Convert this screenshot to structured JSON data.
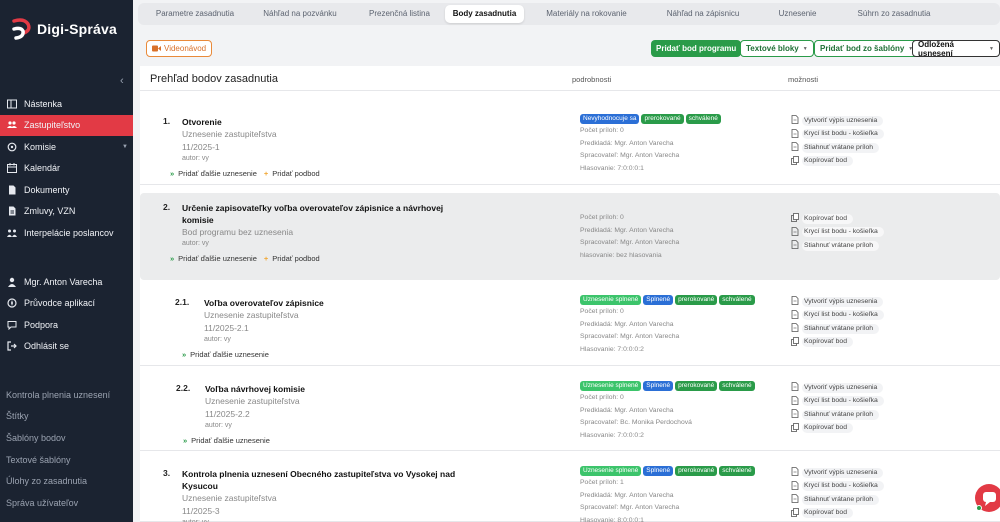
{
  "app": {
    "name": "Digi-Správa",
    "colors": {
      "sidebar": "#1b2331",
      "accent": "#e23a45",
      "green": "#2a9b49",
      "blue": "#2b6fd6"
    }
  },
  "sidebar": {
    "collapse_icon": "chevron-left-icon",
    "items": [
      {
        "label": "Nástenka",
        "icon": "dashboard-icon",
        "active": false
      },
      {
        "label": "Zastupiteľstvo",
        "icon": "users-icon",
        "active": true
      },
      {
        "label": "Komisie",
        "icon": "committee-icon",
        "active": false,
        "has_dropdown": true
      },
      {
        "label": "Kalendár",
        "icon": "calendar-icon",
        "active": false
      },
      {
        "label": "Dokumenty",
        "icon": "document-icon",
        "active": false
      },
      {
        "label": "Zmluvy, VZN",
        "icon": "contract-icon",
        "active": false
      },
      {
        "label": "Interpelácie poslancov",
        "icon": "interpellation-icon",
        "active": false
      }
    ],
    "user_items": [
      {
        "label": "Mgr. Anton Varecha",
        "icon": "user-icon"
      },
      {
        "label": "Průvodce aplikací",
        "icon": "compass-icon"
      },
      {
        "label": "Podpora",
        "icon": "support-icon"
      },
      {
        "label": "Odhlásit se",
        "icon": "logout-icon"
      }
    ],
    "secondary_items": [
      "Kontrola plnenia uznesení",
      "Štítky",
      "Šablóny bodov",
      "Textové šablóny",
      "Úlohy zo zasadnutia",
      "Správa užívateľov"
    ]
  },
  "tabs": [
    {
      "label": "Parametre zasadnutia",
      "active": false
    },
    {
      "label": "Náhľad na pozvánku",
      "active": false
    },
    {
      "label": "Prezenčná listina",
      "active": false
    },
    {
      "label": "Body zasadnutia",
      "active": true
    },
    {
      "label": "Materiály na rokovanie",
      "active": false
    },
    {
      "label": "Náhľad na zápisnicu",
      "active": false
    },
    {
      "label": "Uznesenie",
      "active": false
    },
    {
      "label": "Súhrn zo zasadnutia",
      "active": false
    }
  ],
  "toolbar": {
    "video": "Videonávod",
    "add_point": "Pridať bod programu",
    "text_blocks": "Textové bloky",
    "add_from_template": "Pridať bod zo šablóny",
    "deferred": "Odložená usnesení"
  },
  "panel": {
    "title": "Prehľad bodov zasadnutia",
    "col_details": "podrobnosti",
    "col_options": "možnosti"
  },
  "actions": {
    "more_resolution": "Pridať ďalšie uznesenie",
    "subpoint": "Pridať podbod"
  },
  "points": [
    {
      "num": "1.",
      "title": [
        "Otvorenie"
      ],
      "type": "Uznesenie zastupiteľstva",
      "code": "11/2025-1",
      "author": "autor: vy",
      "badges": [
        {
          "label": "Nevyhodnocuje sa",
          "color": "blue"
        },
        {
          "label": "prerokované",
          "color": "green"
        },
        {
          "label": "schválené",
          "color": "green"
        }
      ],
      "meta": [
        "Počet príloh: 0",
        "Predkladá: Mgr. Anton Varecha",
        "Spracovateľ: Mgr. Anton Varecha",
        "Hlasovanie: 7:0:0:0:1"
      ],
      "options": [
        "Vytvoriť výpis uznesenia",
        "Krycí list bodu - košieľka",
        "Stiahnuť vrátane príloh",
        "Kopírovať bod"
      ],
      "subpoint": true
    },
    {
      "num": "2.",
      "title": [
        "Určenie zapisovateľky voľba overovateľov zápisnice a návrhovej",
        "komisie"
      ],
      "type": "Bod programu bez uznesenia",
      "author": "autor: vy",
      "badges": [],
      "meta": [
        "Počet príloh: 0",
        "Predkladá: Mgr. Anton Varecha",
        "Spracovateľ: Mgr. Anton Varecha",
        "hlasovanie: bez hlasovania"
      ],
      "options": [
        "Kopírovať bod",
        "Krycí list bodu - košieľka",
        "Stiahnuť vrátane príloh"
      ],
      "subpoint": true
    },
    {
      "num": "2.1.",
      "title": [
        "Voľba overovateľov zápisnice"
      ],
      "type": "Uznesenie zastupiteľstva",
      "code": "11/2025-2.1",
      "author": "autor: vy",
      "badges": [
        {
          "label": "Uznesenie splnené",
          "color": "lgreen"
        },
        {
          "label": "Splnené",
          "color": "blue"
        },
        {
          "label": "prerokované",
          "color": "green"
        },
        {
          "label": "schválené",
          "color": "green"
        }
      ],
      "meta": [
        "Počet príloh: 0",
        "Predkladá: Mgr. Anton Varecha",
        "Spracovateľ: Mgr. Anton Varecha",
        "Hlasovanie: 7:0:0:0:2"
      ],
      "options": [
        "Vytvoriť výpis uznesenia",
        "Krycí list bodu - košieľka",
        "Stiahnuť vrátane príloh",
        "Kopírovať bod"
      ],
      "subpoint": false
    },
    {
      "num": "2.2.",
      "title": [
        "Voľba návrhovej komisie"
      ],
      "type": "Uznesenie zastupiteľstva",
      "code": "11/2025-2.2",
      "author": "autor: vy",
      "badges": [
        {
          "label": "Uznesenie splnené",
          "color": "lgreen"
        },
        {
          "label": "Splnené",
          "color": "blue"
        },
        {
          "label": "prerokované",
          "color": "green"
        },
        {
          "label": "schválené",
          "color": "green"
        }
      ],
      "meta": [
        "Počet príloh: 0",
        "Predkladá: Mgr. Anton Varecha",
        "Spracovateľ: Bc. Monika Perdochová",
        "Hlasovanie: 7:0:0:0:2"
      ],
      "options": [
        "Vytvoriť výpis uznesenia",
        "Krycí list bodu - košieľka",
        "Stiahnuť vrátane príloh",
        "Kopírovať bod"
      ],
      "subpoint": false
    },
    {
      "num": "3.",
      "title": [
        "Kontrola plnenia uznesení Obecného zastupiteľstva vo Vysokej nad",
        "Kysucou"
      ],
      "type": "Uznesenie zastupiteľstva",
      "code": "11/2025-3",
      "author": "autor: vy",
      "badges": [
        {
          "label": "Uznesenie splnené",
          "color": "lgreen"
        },
        {
          "label": "Splnené",
          "color": "blue"
        },
        {
          "label": "prerokované",
          "color": "green"
        },
        {
          "label": "schválené",
          "color": "green"
        }
      ],
      "meta": [
        "Počet príloh: 1",
        "Predkladá: Mgr. Anton Varecha",
        "Spracovateľ: Mgr. Anton Varecha",
        "Hlasovanie: 8:0:0:0:1"
      ],
      "options": [
        "Vytvoriť výpis uznesenia",
        "Krycí list bodu - košieľka",
        "Stiahnuť vrátane príloh",
        "Kopírovať bod"
      ],
      "subpoint": false
    }
  ]
}
